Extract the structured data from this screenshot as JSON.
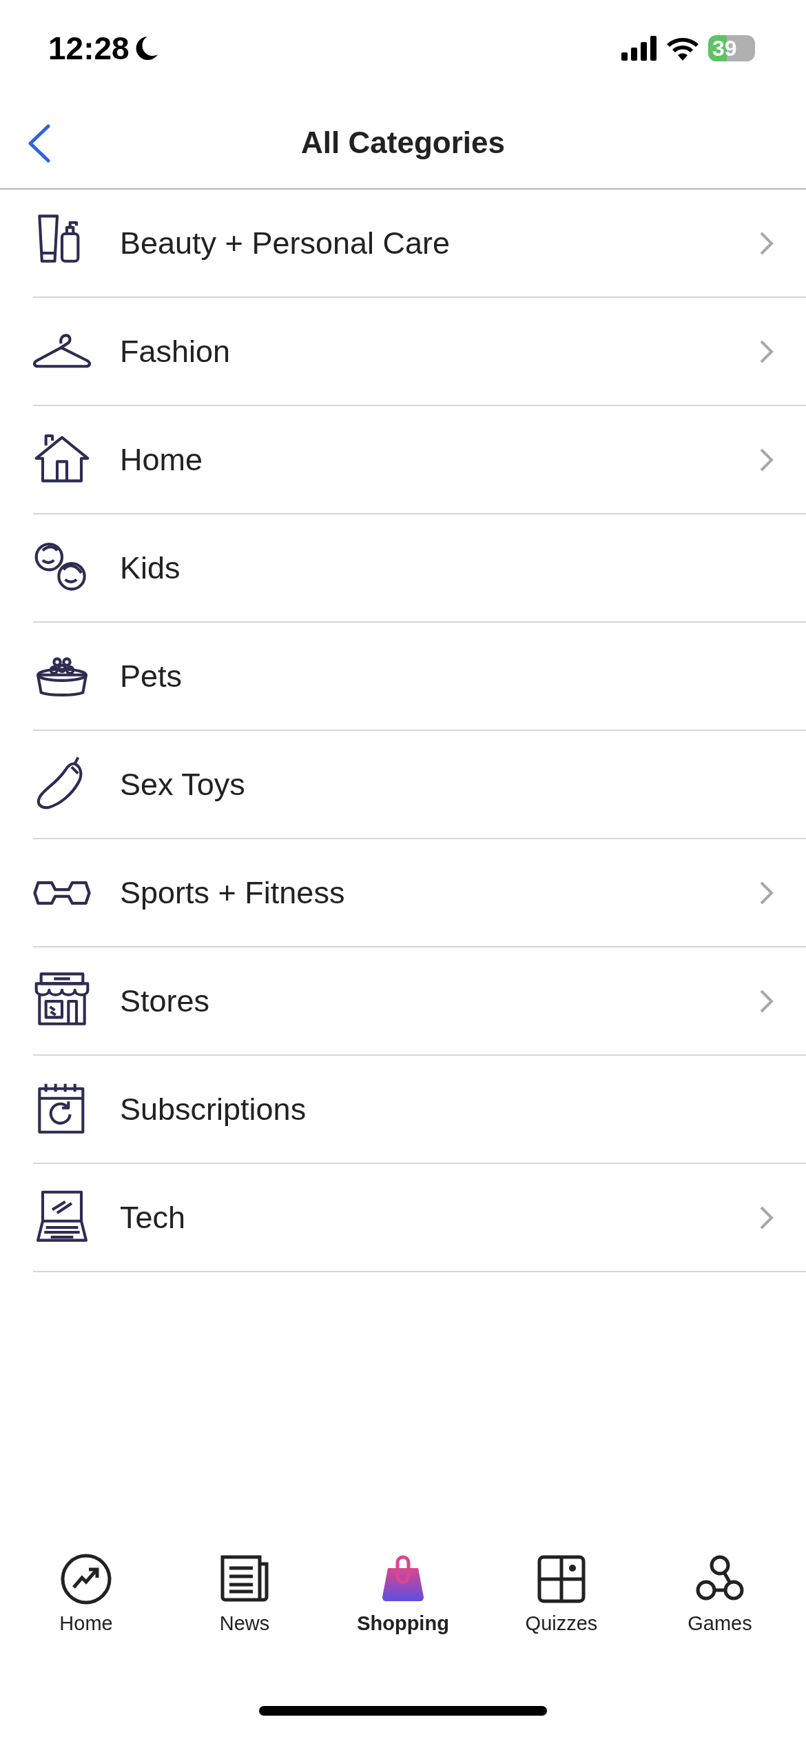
{
  "status_bar": {
    "time": "12:28",
    "battery": "39"
  },
  "nav": {
    "title": "All Categories"
  },
  "categories": [
    {
      "label": "Beauty + Personal Care",
      "kind": "beauty",
      "has_chevron": true
    },
    {
      "label": "Fashion",
      "kind": "fashion",
      "has_chevron": true
    },
    {
      "label": "Home",
      "kind": "home",
      "has_chevron": true
    },
    {
      "label": "Kids",
      "kind": "kids",
      "has_chevron": false
    },
    {
      "label": "Pets",
      "kind": "pets",
      "has_chevron": false
    },
    {
      "label": "Sex Toys",
      "kind": "eggplant",
      "has_chevron": false
    },
    {
      "label": "Sports + Fitness",
      "kind": "sports",
      "has_chevron": true
    },
    {
      "label": "Stores",
      "kind": "stores",
      "has_chevron": true
    },
    {
      "label": "Subscriptions",
      "kind": "subscriptions",
      "has_chevron": false
    },
    {
      "label": "Tech",
      "kind": "tech",
      "has_chevron": true
    }
  ],
  "tab_bar": [
    {
      "label": "Home",
      "kind": "trending",
      "selected": false
    },
    {
      "label": "News",
      "kind": "news",
      "selected": false
    },
    {
      "label": "Shopping",
      "kind": "bag",
      "selected": true
    },
    {
      "label": "Quizzes",
      "kind": "quiz",
      "selected": false
    },
    {
      "label": "Games",
      "kind": "games",
      "selected": false
    }
  ]
}
